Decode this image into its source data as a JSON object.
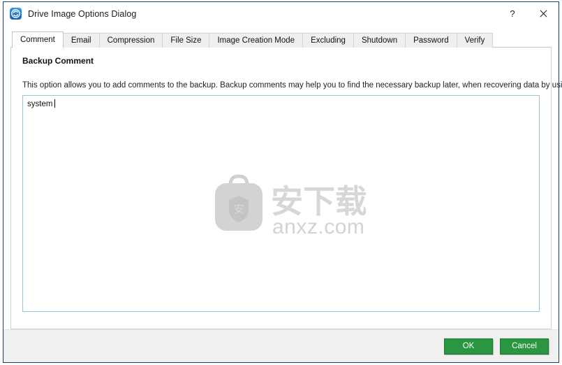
{
  "window": {
    "title": "Drive Image Options Dialog",
    "icon": "refresh-circle-icon",
    "help_label": "?",
    "close_label": "×"
  },
  "tabs": [
    {
      "label": "Comment",
      "active": true
    },
    {
      "label": "Email",
      "active": false
    },
    {
      "label": "Compression",
      "active": false
    },
    {
      "label": "File Size",
      "active": false
    },
    {
      "label": "Image Creation Mode",
      "active": false
    },
    {
      "label": "Excluding",
      "active": false
    },
    {
      "label": "Shutdown",
      "active": false
    },
    {
      "label": "Password",
      "active": false
    },
    {
      "label": "Verify",
      "active": false
    }
  ],
  "panel": {
    "heading": "Backup Comment",
    "description": "This option allows you to add comments to the backup. Backup comments may help you to find the necessary backup later, when recovering data by using bootable media.",
    "comment_value": "system",
    "comment_placeholder": ""
  },
  "watermark": {
    "chinese_text": "安下载",
    "domain_text": "anxz.com",
    "badge_char": "安"
  },
  "footer": {
    "ok_label": "OK",
    "cancel_label": "Cancel"
  },
  "colors": {
    "accent_green": "#2a9642",
    "window_border": "#1b3f66",
    "field_border": "#9cc3d8"
  }
}
